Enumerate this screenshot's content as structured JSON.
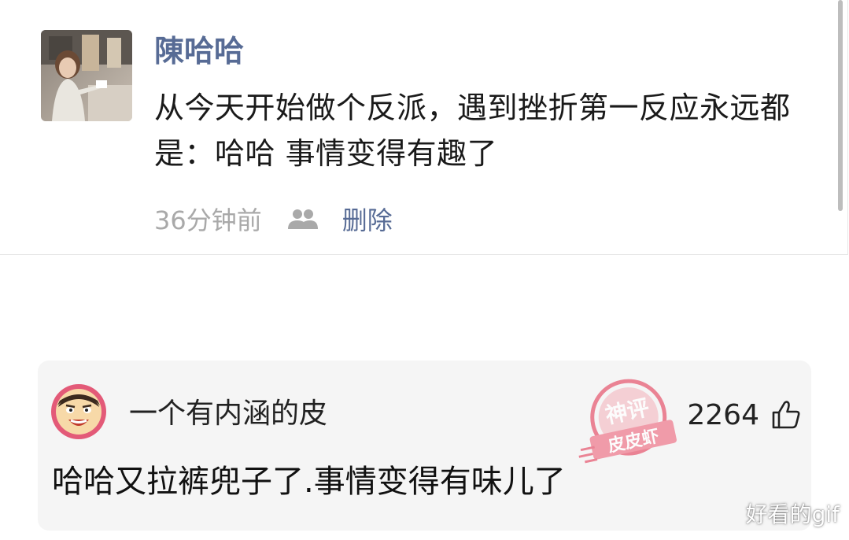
{
  "moment": {
    "author": "陳哈哈",
    "text": "从今天开始做个反派，遇到挫折第一反应永远都是：哈哈 事情变得有趣了",
    "time": "36分钟前",
    "visibility_icon": "friends-icon",
    "delete_label": "删除"
  },
  "comment": {
    "author": "一个有内涵的皮",
    "likes": "2264",
    "like_icon": "thumb-up-icon",
    "text": "哈哈又拉裤兜子了.事情变得有味儿了",
    "stamp": {
      "top_text": "神评",
      "bottom_text": "皮皮虾"
    }
  },
  "watermark": "好看的gif",
  "colors": {
    "link_blue": "#576b95",
    "meta_gray": "#a9a9a9",
    "comment_bg": "#f5f5f5",
    "stamp_red": "#e8647a"
  }
}
